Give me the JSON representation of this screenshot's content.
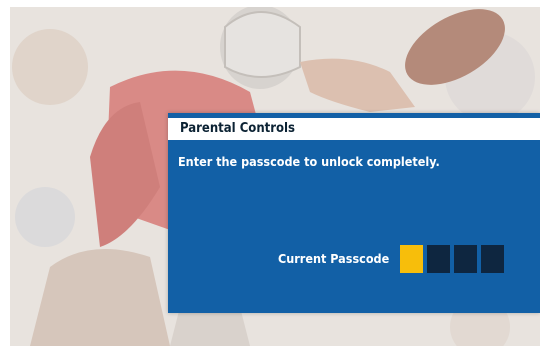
{
  "dialog": {
    "title": "Parental Controls",
    "prompt": "Enter the passcode to unlock completely.",
    "passcode_label": "Current Passcode",
    "passcode_digits": 4,
    "active_digit_index": 0
  },
  "colors": {
    "dialog_bg": "#1260a6",
    "title_bar_bg": "#ffffff",
    "title_text": "#0b2233",
    "digit_empty": "#0e2640",
    "digit_active": "#f7be0b",
    "background": "#e9e4df"
  }
}
